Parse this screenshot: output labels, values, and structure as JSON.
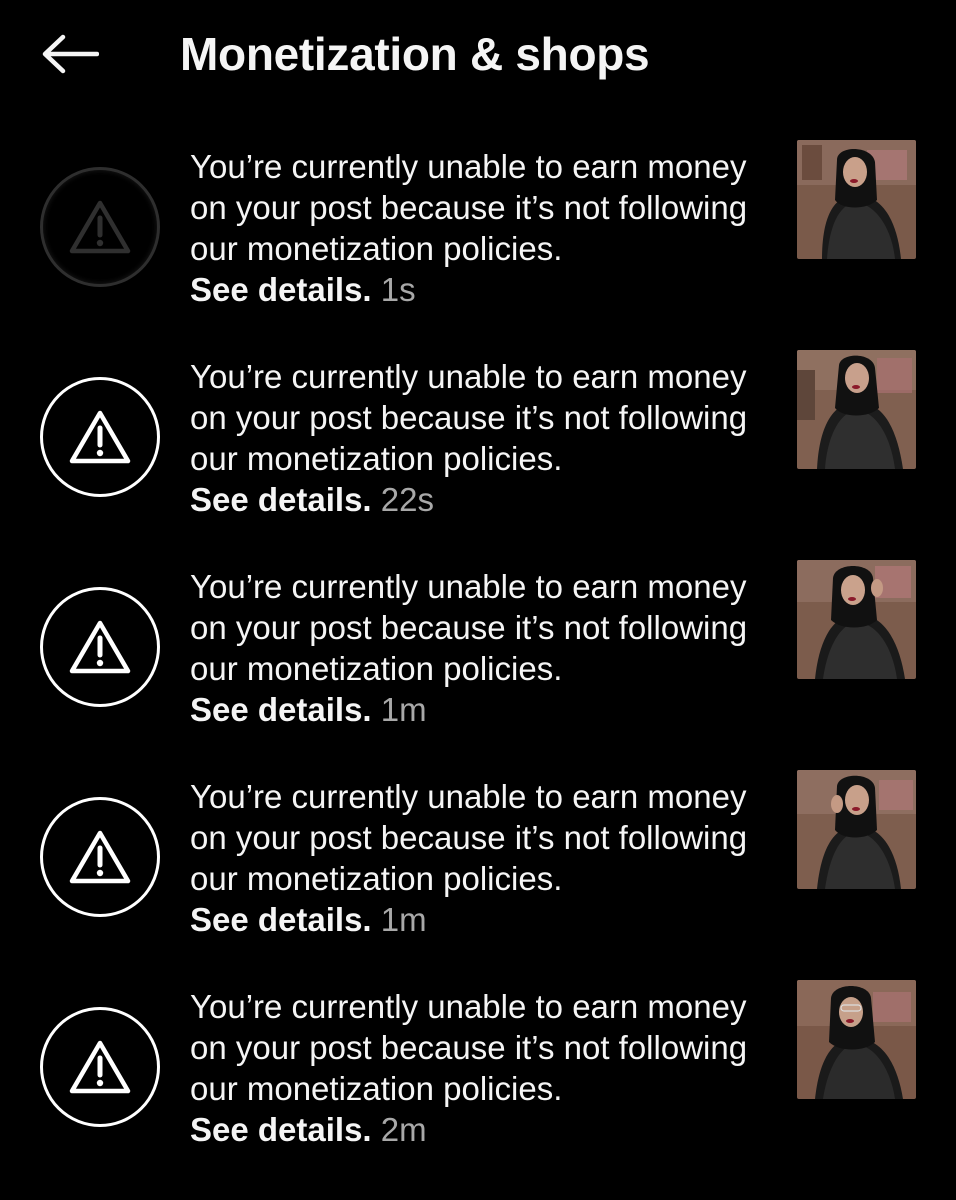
{
  "header": {
    "title": "Monetization & shops",
    "back_icon": "arrow-left-icon"
  },
  "notifications": [
    {
      "icon": "warning-triangle-icon",
      "body": "You’re currently unable to earn money on your post because it’s not following our monetization policies.",
      "link": "See details.",
      "time": "1s",
      "faded": true
    },
    {
      "icon": "warning-triangle-icon",
      "body": "You’re currently unable to earn money on your post because it’s not following our monetization policies.",
      "link": "See details.",
      "time": "22s",
      "faded": false
    },
    {
      "icon": "warning-triangle-icon",
      "body": "You’re currently unable to earn money on your post because it’s not following our monetization policies.",
      "link": "See details.",
      "time": "1m",
      "faded": false
    },
    {
      "icon": "warning-triangle-icon",
      "body": "You’re currently unable to earn money on your post because it’s not following our monetization policies.",
      "link": "See details.",
      "time": "1m",
      "faded": false
    },
    {
      "icon": "warning-triangle-icon",
      "body": "You’re currently unable to earn money on your post because it’s not following our monetization policies.",
      "link": "See details.",
      "time": "2m",
      "faded": false
    }
  ],
  "colors": {
    "background": "#000000",
    "text": "#f5f5f5",
    "timestamp": "#a8a8a8",
    "icon_ring": "#ffffff"
  }
}
